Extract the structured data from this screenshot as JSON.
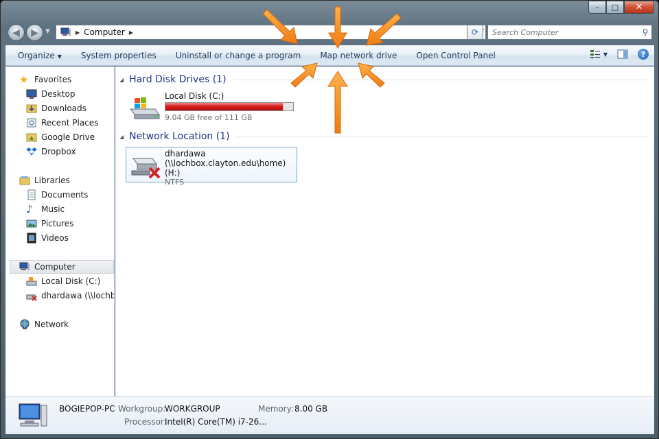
{
  "window": {
    "caption_min": "–",
    "caption_max": "□",
    "caption_close": "✕"
  },
  "address": {
    "crumbs": [
      "Computer"
    ],
    "search_placeholder": "Search Computer"
  },
  "command_bar": {
    "organize": "Organize",
    "system_properties": "System properties",
    "uninstall": "Uninstall or change a program",
    "map_network_drive": "Map network drive",
    "open_control_panel": "Open Control Panel"
  },
  "nav": {
    "favorites": "Favorites",
    "favorites_items": [
      "Desktop",
      "Downloads",
      "Recent Places",
      "Google Drive",
      "Dropbox"
    ],
    "libraries": "Libraries",
    "libraries_items": [
      "Documents",
      "Music",
      "Pictures",
      "Videos"
    ],
    "computer": "Computer",
    "computer_items": [
      "Local Disk (C:)",
      "dhardawa (\\\\lochbo"
    ],
    "network": "Network"
  },
  "content": {
    "hdd_header": "Hard Disk Drives (1)",
    "local_disk_name": "Local Disk (C:)",
    "local_disk_free": "9.04 GB free of 111 GB",
    "local_disk_used_fraction": 0.919,
    "net_header": "Network Location (1)",
    "net_name": "dhardawa",
    "net_path": "(\\\\lochbox.clayton.edu\\home) (H:)",
    "net_fs": "NTFS"
  },
  "details": {
    "pc_name": "BOGIEPOP-PC",
    "workgroup_label": "Workgroup:",
    "workgroup_value": "WORKGROUP",
    "memory_label": "Memory:",
    "memory_value": "8.00 GB",
    "processor_label": "Processor:",
    "processor_value": "Intel(R) Core(TM) i7-26..."
  },
  "colors": {
    "arrow": "#f7901e",
    "usage_bar": "#d61e1e",
    "group_header": "#1e3287"
  }
}
